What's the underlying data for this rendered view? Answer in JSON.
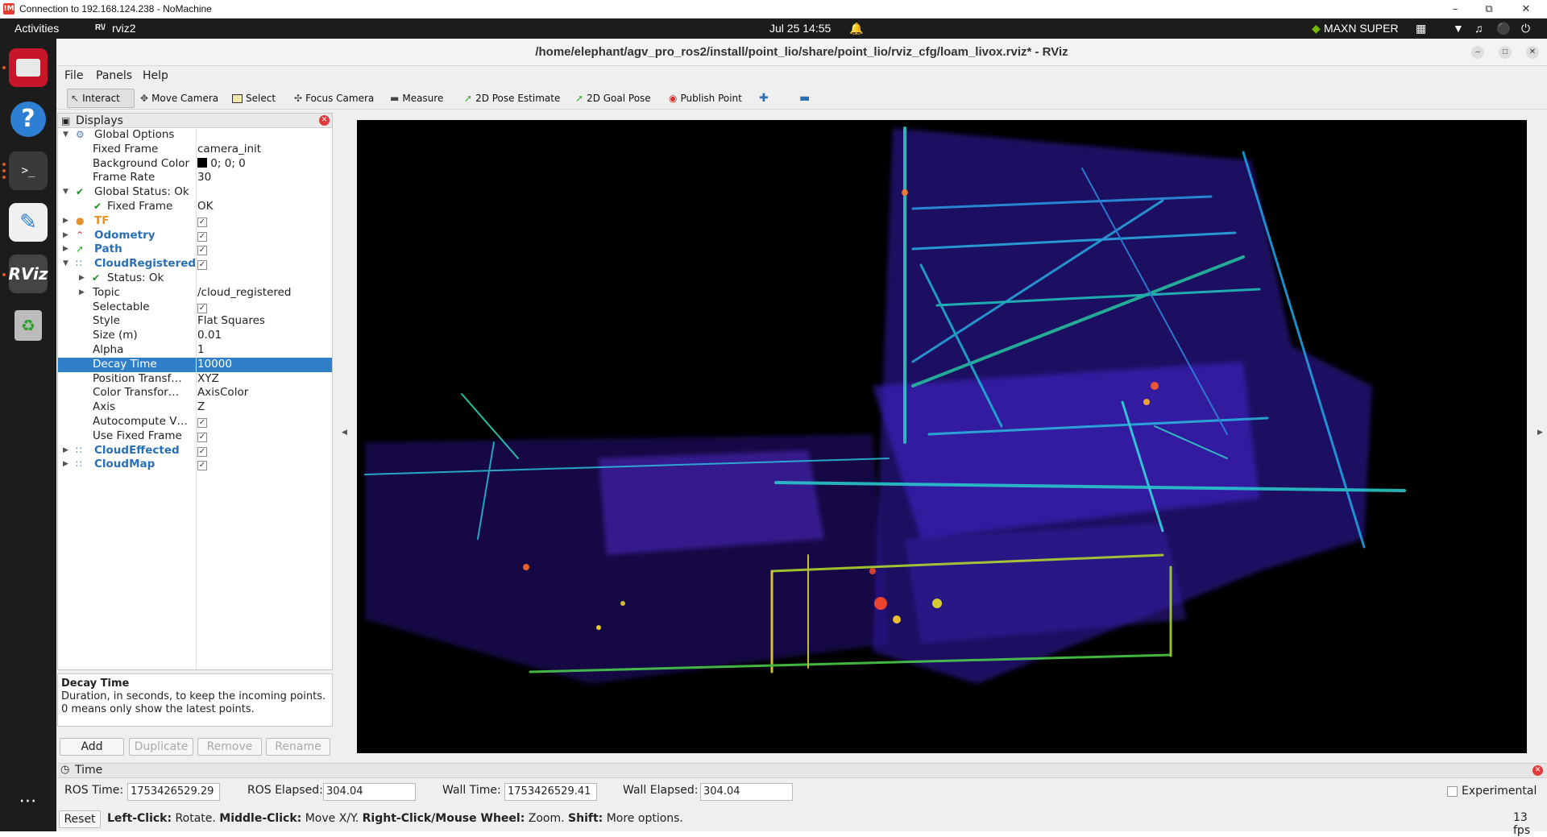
{
  "nomachine": {
    "title": "Connection to 192.168.124.238 - NoMachine",
    "logo": "!M",
    "icons": [
      "minimize-icon",
      "restore-icon",
      "close-icon"
    ]
  },
  "gnome": {
    "activities": "Activities",
    "app": "rviz2",
    "clock": "Jul 25  14:55",
    "power_mode": "MAXN SUPER"
  },
  "window": {
    "title": "/home/elephant/agv_pro_ros2/install/point_lio/share/point_lio/rviz_cfg/loam_livox.rviz* - RViz"
  },
  "menu": {
    "file": "File",
    "panels": "Panels",
    "help": "Help"
  },
  "toolbar": {
    "interact": "Interact",
    "move_camera": "Move Camera",
    "select": "Select",
    "focus_camera": "Focus Camera",
    "measure": "Measure",
    "pose_estimate": "2D Pose Estimate",
    "goal_pose": "2D Goal Pose",
    "publish_point": "Publish Point"
  },
  "displays": {
    "title": "Displays",
    "rows": [
      {
        "name": "Global Options",
        "value": ""
      },
      {
        "name": "Fixed Frame",
        "value": "camera_init"
      },
      {
        "name": "Background Color",
        "value": "0; 0; 0"
      },
      {
        "name": "Frame Rate",
        "value": "30"
      },
      {
        "name": "Global Status: Ok",
        "value": ""
      },
      {
        "name": "Fixed Frame",
        "value": "OK"
      },
      {
        "name": "TF",
        "value": ""
      },
      {
        "name": "Odometry",
        "value": ""
      },
      {
        "name": "Path",
        "value": ""
      },
      {
        "name": "CloudRegistered",
        "value": ""
      },
      {
        "name": "Status: Ok",
        "value": ""
      },
      {
        "name": "Topic",
        "value": "/cloud_registered"
      },
      {
        "name": "Selectable",
        "value": ""
      },
      {
        "name": "Style",
        "value": "Flat Squares"
      },
      {
        "name": "Size (m)",
        "value": "0.01"
      },
      {
        "name": "Alpha",
        "value": "1"
      },
      {
        "name": "Decay Time",
        "value": "10000"
      },
      {
        "name": "Position Transf…",
        "value": "XYZ"
      },
      {
        "name": "Color Transfor…",
        "value": "AxisColor"
      },
      {
        "name": "Axis",
        "value": "Z"
      },
      {
        "name": "Autocompute V…",
        "value": ""
      },
      {
        "name": "Use Fixed Frame",
        "value": ""
      },
      {
        "name": "CloudEffected",
        "value": ""
      },
      {
        "name": "CloudMap",
        "value": ""
      }
    ],
    "description_title": "Decay Time",
    "description": "Duration, in seconds, to keep the incoming points. 0 means only show the latest points.",
    "buttons": {
      "add": "Add",
      "duplicate": "Duplicate",
      "remove": "Remove",
      "rename": "Rename"
    }
  },
  "time": {
    "title": "Time",
    "ros_time_label": "ROS Time:",
    "ros_time": "1753426529.29",
    "ros_elapsed_label": "ROS Elapsed:",
    "ros_elapsed": "304.04",
    "wall_time_label": "Wall Time:",
    "wall_time": "1753426529.41",
    "wall_elapsed_label": "Wall Elapsed:",
    "wall_elapsed": "304.04",
    "experimental": "Experimental"
  },
  "status": {
    "reset": "Reset",
    "left": "Left-Click:",
    "left_t": " Rotate. ",
    "middle": "Middle-Click:",
    "middle_t": " Move X/Y. ",
    "right": "Right-Click/Mouse Wheel:",
    "right_t": " Zoom. ",
    "shift": "Shift:",
    "shift_t": " More options.",
    "fps": "13 fps"
  },
  "colors": {
    "selection": "#2f80c8",
    "ubuntu_orange": "#e95420",
    "viewport_bg": "#000000"
  }
}
